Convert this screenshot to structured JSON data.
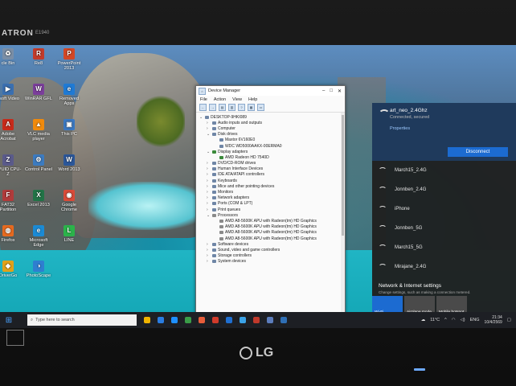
{
  "monitor": {
    "brand_top": "ATRON",
    "model_top": "E1940",
    "logo": "LG"
  },
  "desktop_icons": [
    {
      "name": "cle Bin",
      "color": "#7a8ea6",
      "glyph": "♻"
    },
    {
      "name": "Re8",
      "color": "#c23b2b",
      "glyph": "R"
    },
    {
      "name": "PowerPoint 2013",
      "color": "#d24726",
      "glyph": "P"
    },
    {
      "name": "osoft Video",
      "color": "#3a6fb0",
      "glyph": "▶"
    },
    {
      "name": "WinRAR GFL",
      "color": "#7b3e9b",
      "glyph": "W"
    },
    {
      "name": "Removed Apps",
      "color": "#1f7ad4",
      "glyph": "e"
    },
    {
      "name": "Adobe Acrobat",
      "color": "#c72a1a",
      "glyph": "A"
    },
    {
      "name": "VLC media player",
      "color": "#f08a0c",
      "glyph": "▲"
    },
    {
      "name": "This PC",
      "color": "#3a78c2",
      "glyph": "▣"
    },
    {
      "name": "CPUID CPU-Z",
      "color": "#5a5a8a",
      "glyph": "Z"
    },
    {
      "name": "Control Panel",
      "color": "#3c7bc0",
      "glyph": "⚙"
    },
    {
      "name": "Word 2013",
      "color": "#2b579a",
      "glyph": "W"
    },
    {
      "name": "FAT32 Partition",
      "color": "#b03b3b",
      "glyph": "F"
    },
    {
      "name": "Excel 2013",
      "color": "#217346",
      "glyph": "X"
    },
    {
      "name": "Google Chrome",
      "color": "#d94a38",
      "glyph": "◉"
    },
    {
      "name": "Firefox",
      "color": "#e66a1f",
      "glyph": "◍"
    },
    {
      "name": "Microsoft Edge",
      "color": "#1b8ad4",
      "glyph": "e"
    },
    {
      "name": "LINE",
      "color": "#2bb34a",
      "glyph": "L"
    },
    {
      "name": "DriverGo",
      "color": "#e0a11a",
      "glyph": "◆"
    },
    {
      "name": "PhotoScape",
      "color": "#2e7fd0",
      "glyph": "◑"
    }
  ],
  "device_manager": {
    "title": "Device Manager",
    "menu": [
      "File",
      "Action",
      "View",
      "Help"
    ],
    "tree": [
      {
        "label": "DESKTOP-9HKI089",
        "depth": 0,
        "exp": "⌄",
        "icon": "pc"
      },
      {
        "label": "Audio inputs and outputs",
        "depth": 1,
        "exp": "›",
        "icon": "dev"
      },
      {
        "label": "Computer",
        "depth": 1,
        "exp": "›",
        "icon": "dev"
      },
      {
        "label": "Disk drives",
        "depth": 1,
        "exp": "⌄",
        "icon": "dev"
      },
      {
        "label": "Maxtor 6V160E0",
        "depth": 2,
        "exp": "",
        "icon": "dev"
      },
      {
        "label": "WDC WD5000AAKX-00ERMA0",
        "depth": 2,
        "exp": "",
        "icon": "dev"
      },
      {
        "label": "Display adapters",
        "depth": 1,
        "exp": "⌄",
        "icon": "gpu"
      },
      {
        "label": "AMD Radeon HD 7540D",
        "depth": 2,
        "exp": "",
        "icon": "gpu"
      },
      {
        "label": "DVD/CD-ROM drives",
        "depth": 1,
        "exp": "›",
        "icon": "dev"
      },
      {
        "label": "Human Interface Devices",
        "depth": 1,
        "exp": "›",
        "icon": "dev"
      },
      {
        "label": "IDE ATA/ATAPI controllers",
        "depth": 1,
        "exp": "›",
        "icon": "dev"
      },
      {
        "label": "Keyboards",
        "depth": 1,
        "exp": "›",
        "icon": "dev"
      },
      {
        "label": "Mice and other pointing devices",
        "depth": 1,
        "exp": "›",
        "icon": "dev"
      },
      {
        "label": "Monitors",
        "depth": 1,
        "exp": "›",
        "icon": "dev"
      },
      {
        "label": "Network adapters",
        "depth": 1,
        "exp": "›",
        "icon": "dev"
      },
      {
        "label": "Ports (COM & LPT)",
        "depth": 1,
        "exp": "›",
        "icon": "dev"
      },
      {
        "label": "Print queues",
        "depth": 1,
        "exp": "›",
        "icon": "dev"
      },
      {
        "label": "Processors",
        "depth": 1,
        "exp": "⌄",
        "icon": "cpu"
      },
      {
        "label": "AMD A8-5600K APU with Radeon(tm) HD Graphics",
        "depth": 2,
        "exp": "",
        "icon": "cpu"
      },
      {
        "label": "AMD A8-5600K APU with Radeon(tm) HD Graphics",
        "depth": 2,
        "exp": "",
        "icon": "cpu"
      },
      {
        "label": "AMD A8-5600K APU with Radeon(tm) HD Graphics",
        "depth": 2,
        "exp": "",
        "icon": "cpu"
      },
      {
        "label": "AMD A8-5600K APU with Radeon(tm) HD Graphics",
        "depth": 2,
        "exp": "",
        "icon": "cpu"
      },
      {
        "label": "Software devices",
        "depth": 1,
        "exp": "›",
        "icon": "dev"
      },
      {
        "label": "Sound, video and game controllers",
        "depth": 1,
        "exp": "›",
        "icon": "dev"
      },
      {
        "label": "Storage controllers",
        "depth": 1,
        "exp": "›",
        "icon": "dev"
      },
      {
        "label": "System devices",
        "depth": 1,
        "exp": "›",
        "icon": "dev"
      }
    ]
  },
  "network": {
    "connected": {
      "name": "art_neo_2.4Ghz",
      "status": "Connected, secured",
      "properties": "Properties",
      "disconnect": "Disconnect"
    },
    "networks": [
      "March15_2.4G",
      "Jonnben_2.4G",
      "iPhone",
      "Jonnben_5G",
      "March15_5G",
      "Mirajane_2.4G"
    ],
    "settings_title": "Network & Internet settings",
    "settings_desc": "Change settings, such as making a connection metered.",
    "quick_actions": [
      {
        "label": "Wi-Fi",
        "active": true
      },
      {
        "label": "Airplane mode",
        "active": false
      },
      {
        "label": "Mobile hotspot",
        "active": false
      }
    ]
  },
  "taskbar": {
    "search_placeholder": "Type here to search",
    "weather": "11°C",
    "lang": "ENG",
    "time": "21:34",
    "date": "10/4/2569",
    "app_colors": [
      "#f0b400",
      "#2a7de1",
      "#1e90ff",
      "#3a9d48",
      "#e85d3a",
      "#d13b2b",
      "#1f6fd1",
      "#3ba3e8",
      "#c0392b",
      "#5c7dbd",
      "#2f6fb5"
    ]
  }
}
